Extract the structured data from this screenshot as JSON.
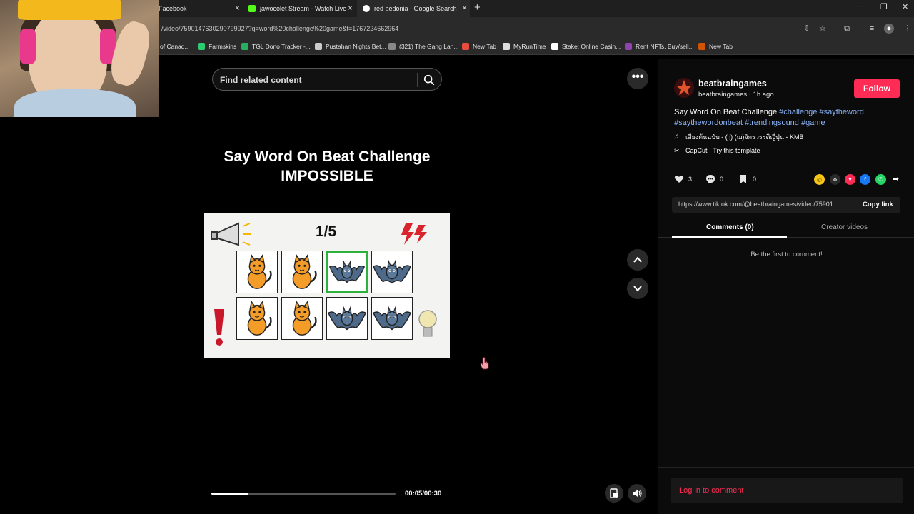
{
  "browser": {
    "tabs": [
      {
        "label": "Facebook",
        "close": "×"
      },
      {
        "label": "jawocolet Stream - Watch Live",
        "close": "×"
      },
      {
        "label": "red bedonia - Google Search",
        "close": "×"
      }
    ],
    "new_tab": "+",
    "window_controls": {
      "minimize": "─",
      "restore": "❐",
      "close": "✕"
    },
    "url": "/video/7590147630290799927?q=word%20challenge%20game&t=1767224662964",
    "bookmarks": [
      {
        "label": "of Canad...",
        "icon_color": "#c0392b"
      },
      {
        "label": "Farmskins",
        "icon_color": "#2ecc71"
      },
      {
        "label": "TGL Dono Tracker -...",
        "icon_color": "#27ae60"
      },
      {
        "label": "Pustahan Nights Bet...",
        "icon_color": "#cccccc"
      },
      {
        "label": "(321) The Gang Lan...",
        "icon_color": "#888888"
      },
      {
        "label": "New Tab",
        "icon_color": "#e74c3c"
      },
      {
        "label": "MyRunTime",
        "icon_color": "#dddddd"
      },
      {
        "label": "Stake: Online Casin...",
        "icon_color": "#ffffff"
      },
      {
        "label": "Rent NFTs. Buy/sell...",
        "icon_color": "#8e44ad"
      },
      {
        "label": "New Tab",
        "icon_color": "#d35400"
      }
    ]
  },
  "video": {
    "search_placeholder": "Find related content",
    "title_line1": "Say Word On Beat Challenge",
    "title_line2": "IMPOSSIBLE",
    "counter": "1/5",
    "grid": [
      [
        "cat",
        "cat",
        "bat",
        "bat"
      ],
      [
        "cat",
        "cat",
        "bat",
        "bat"
      ]
    ],
    "selected_cell": 2,
    "progress_fraction": 0.2,
    "time": "00:05/00:30",
    "more": "•••"
  },
  "creator": {
    "username": "beatbraingames",
    "subline": "beatbraingames · 1h ago",
    "follow_label": "Follow",
    "description_text": "Say Word On Beat Challenge ",
    "hashtags": [
      "#challenge",
      "#saytheword",
      "#saythewordonbeat",
      "#trendingsound",
      "#game"
    ],
    "music": "เสียงต้นฉบับ - (ๅ) (ฌ)จักรวรรดิญี่ปุ่น - KMB",
    "capcut": "CapCut · Try this template"
  },
  "actions": {
    "likes": "3",
    "comments": "0",
    "saves": "0",
    "share_icons": [
      {
        "name": "coin",
        "color": "#f5c518",
        "glyph": "◎"
      },
      {
        "name": "embed",
        "color": "#2a2a2a",
        "glyph": "‹›"
      },
      {
        "name": "send",
        "color": "#fe2c55",
        "glyph": "▾"
      },
      {
        "name": "facebook",
        "color": "#1877f2",
        "glyph": "f"
      },
      {
        "name": "whatsapp",
        "color": "#25d366",
        "glyph": "✆"
      },
      {
        "name": "forward",
        "color": "#0b0b0b",
        "glyph": "➦"
      }
    ]
  },
  "link": {
    "url": "https://www.tiktok.com/@beatbraingames/video/75901...",
    "copy_label": "Copy link"
  },
  "comments_tabs": {
    "comments": "Comments (0)",
    "creator_videos": "Creator videos"
  },
  "empty_comments": "Be the first to comment!",
  "login_prompt": "Log in to comment",
  "colors": {
    "accent": "#fe2c55",
    "hashtag": "#8ab4f8",
    "selected_cell": "#2db13c"
  }
}
